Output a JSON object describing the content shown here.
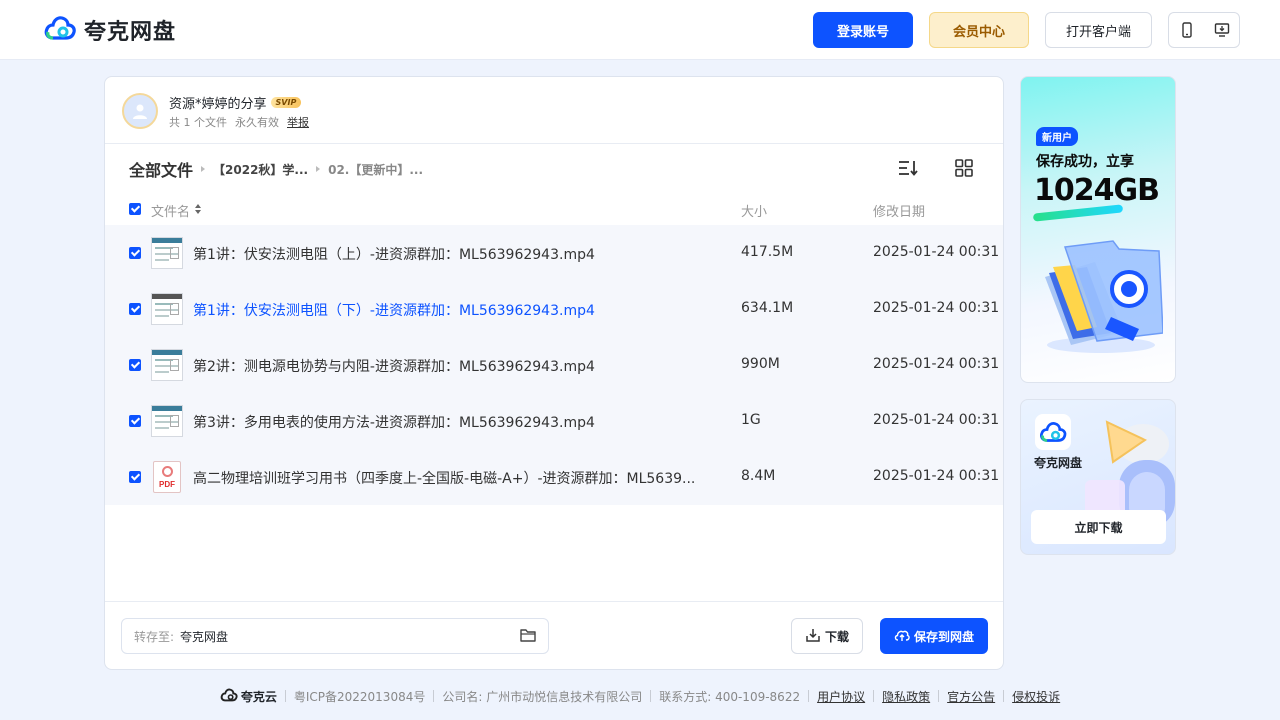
{
  "header": {
    "logo_text": "夸克网盘",
    "login_label": "登录账号",
    "vip_label": "会员中心",
    "client_label": "打开客户端"
  },
  "share": {
    "title": "资源*婷婷的分享",
    "badge": "SVIP",
    "file_count": "共 1 个文件",
    "validity": "永久有效",
    "report": "举报"
  },
  "breadcrumb": {
    "root": "全部文件",
    "items": [
      "【2022秋】学...",
      "02.【更新中】..."
    ]
  },
  "table": {
    "col_name": "文件名",
    "col_size": "大小",
    "col_date": "修改日期",
    "rows": [
      {
        "name": "第1讲：伏安法测电阻（上）-进资源群加：ML563962943.mp4",
        "size": "417.5M",
        "date": "2025-01-24 00:31",
        "type": "video",
        "checked": true
      },
      {
        "name": "第1讲：伏安法测电阻（下）-进资源群加：ML563962943.mp4",
        "size": "634.1M",
        "date": "2025-01-24 00:31",
        "type": "video",
        "checked": true
      },
      {
        "name": "第2讲：测电源电协势与内阻-进资源群加：ML563962943.mp4",
        "size": "990M",
        "date": "2025-01-24 00:31",
        "type": "video",
        "checked": true
      },
      {
        "name": "第3讲：多用电表的使用方法-进资源群加：ML563962943.mp4",
        "size": "1G",
        "date": "2025-01-24 00:31",
        "type": "video",
        "checked": true
      },
      {
        "name": "高二物理培训班学习用书（四季度上-全国版-电磁-A+）-进资源群加：ML5639...",
        "size": "8.4M",
        "date": "2025-01-24 00:31",
        "type": "pdf",
        "checked": true
      }
    ]
  },
  "pdf_label": "PDF",
  "bottom": {
    "saveto_label": "转存至:",
    "saveto_value": "夸克网盘",
    "download_label": "下载",
    "save_label": "保存到网盘"
  },
  "ads": {
    "ad1_tag": "新用户",
    "ad1_line1": "保存成功，立享",
    "ad1_big": "1024GB",
    "ad2_name": "夸克网盘",
    "ad2_button": "立即下载"
  },
  "footer": {
    "brand": "夸克云",
    "icp": "粤ICP备2022013084号",
    "company": "公司名: 广州市动悦信息技术有限公司",
    "contact": "联系方式: 400-109-8622",
    "links": [
      "用户协议",
      "隐私政策",
      "官方公告",
      "侵权投诉"
    ]
  },
  "colors": {
    "brand_blue": "#0d53ff",
    "page_bg": "#eef3fd",
    "row_bg": "#f5f7fc"
  }
}
